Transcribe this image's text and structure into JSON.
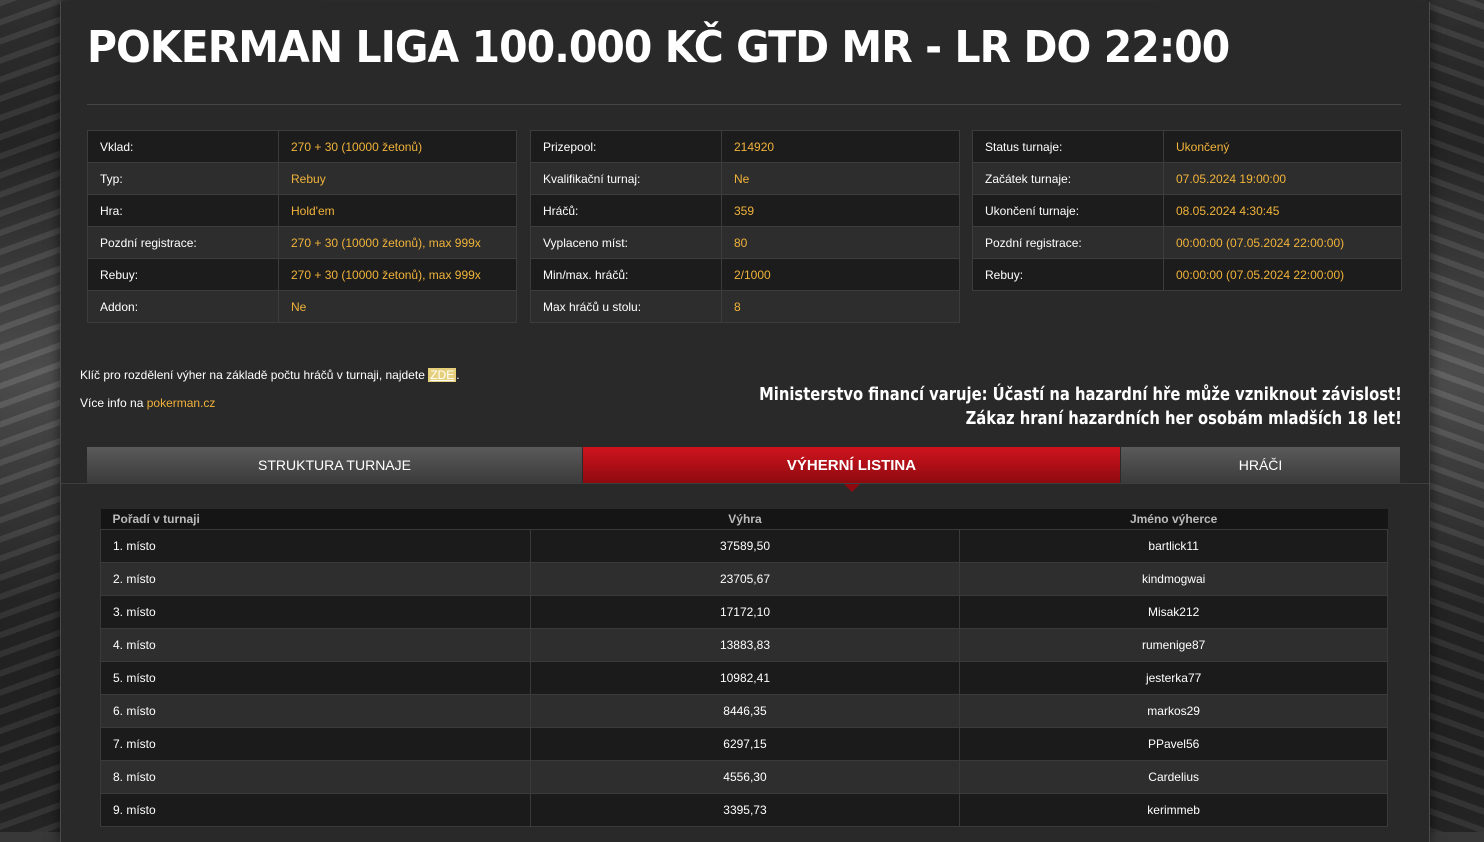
{
  "title": "POKERMAN LIGA 100.000 KČ GTD MR - LR DO 22:00",
  "info_left": [
    {
      "key": "Vklad:",
      "value": "270 + 30 (10000 žetonů)"
    },
    {
      "key": "Typ:",
      "value": "Rebuy"
    },
    {
      "key": "Hra:",
      "value": "Hold'em"
    },
    {
      "key": "Pozdní registrace:",
      "value": "270 + 30 (10000 žetonů), max 999x"
    },
    {
      "key": "Rebuy:",
      "value": "270 + 30 (10000 žetonů), max 999x"
    },
    {
      "key": "Addon:",
      "value": "Ne"
    }
  ],
  "info_middle": [
    {
      "key": "Prizepool:",
      "value": "214920"
    },
    {
      "key": "Kvalifikační turnaj:",
      "value": "Ne"
    },
    {
      "key": "Hráčů:",
      "value": "359"
    },
    {
      "key": "Vyplaceno míst:",
      "value": "80"
    },
    {
      "key": "Min/max. hráčů:",
      "value": "2/1000"
    },
    {
      "key": "Max hráčů u stolu:",
      "value": "8"
    }
  ],
  "info_right": [
    {
      "key": "Status turnaje:",
      "value": "Ukončený"
    },
    {
      "key": "Začátek turnaje:",
      "value": "07.05.2024 19:00:00"
    },
    {
      "key": "Ukončení turnaje:",
      "value": "08.05.2024 4:30:45"
    },
    {
      "key": "Pozdní registrace:",
      "value": "00:00:00 (07.05.2024 22:00:00)"
    },
    {
      "key": "Rebuy:",
      "value": "00:00:00 (07.05.2024 22:00:00)"
    }
  ],
  "notes": {
    "key_text": "Klíč pro rozdělení výher na základě počtu hráčů v turnaji, najdete ",
    "key_link": "ZDE",
    "key_end": ".",
    "more_text": "Více info na ",
    "more_link": "pokerman.cz"
  },
  "warning": {
    "line1": "Ministerstvo financí varuje: Účastí na hazardní hře může vzniknout závislost!",
    "line2": "Zákaz hraní hazardních her osobám mladších 18 let!"
  },
  "tabs": {
    "structure": "STRUKTURA TURNAJE",
    "winners": "VÝHERNÍ LISTINA",
    "players": "HRÁČI",
    "active": "winners"
  },
  "winners_table": {
    "headers": [
      "Pořadí v turnaji",
      "Výhra",
      "Jméno výherce"
    ],
    "rows": [
      [
        "1. místo",
        "37589,50",
        "bartlick11"
      ],
      [
        "2. místo",
        "23705,67",
        "kindmogwai"
      ],
      [
        "3. místo",
        "17172,10",
        "Misak212"
      ],
      [
        "4. místo",
        "13883,83",
        "rumenige87"
      ],
      [
        "5. místo",
        "10982,41",
        "jesterka77"
      ],
      [
        "6. místo",
        "8446,35",
        "markos29"
      ],
      [
        "7. místo",
        "6297,15",
        "PPavel56"
      ],
      [
        "8. místo",
        "4556,30",
        "Cardelius"
      ],
      [
        "9. místo",
        "3395,73",
        "kerimmeb"
      ]
    ]
  },
  "colors": {
    "accent": "#f0b33a",
    "tab_active": "#c8121b",
    "panel": "#292929"
  }
}
